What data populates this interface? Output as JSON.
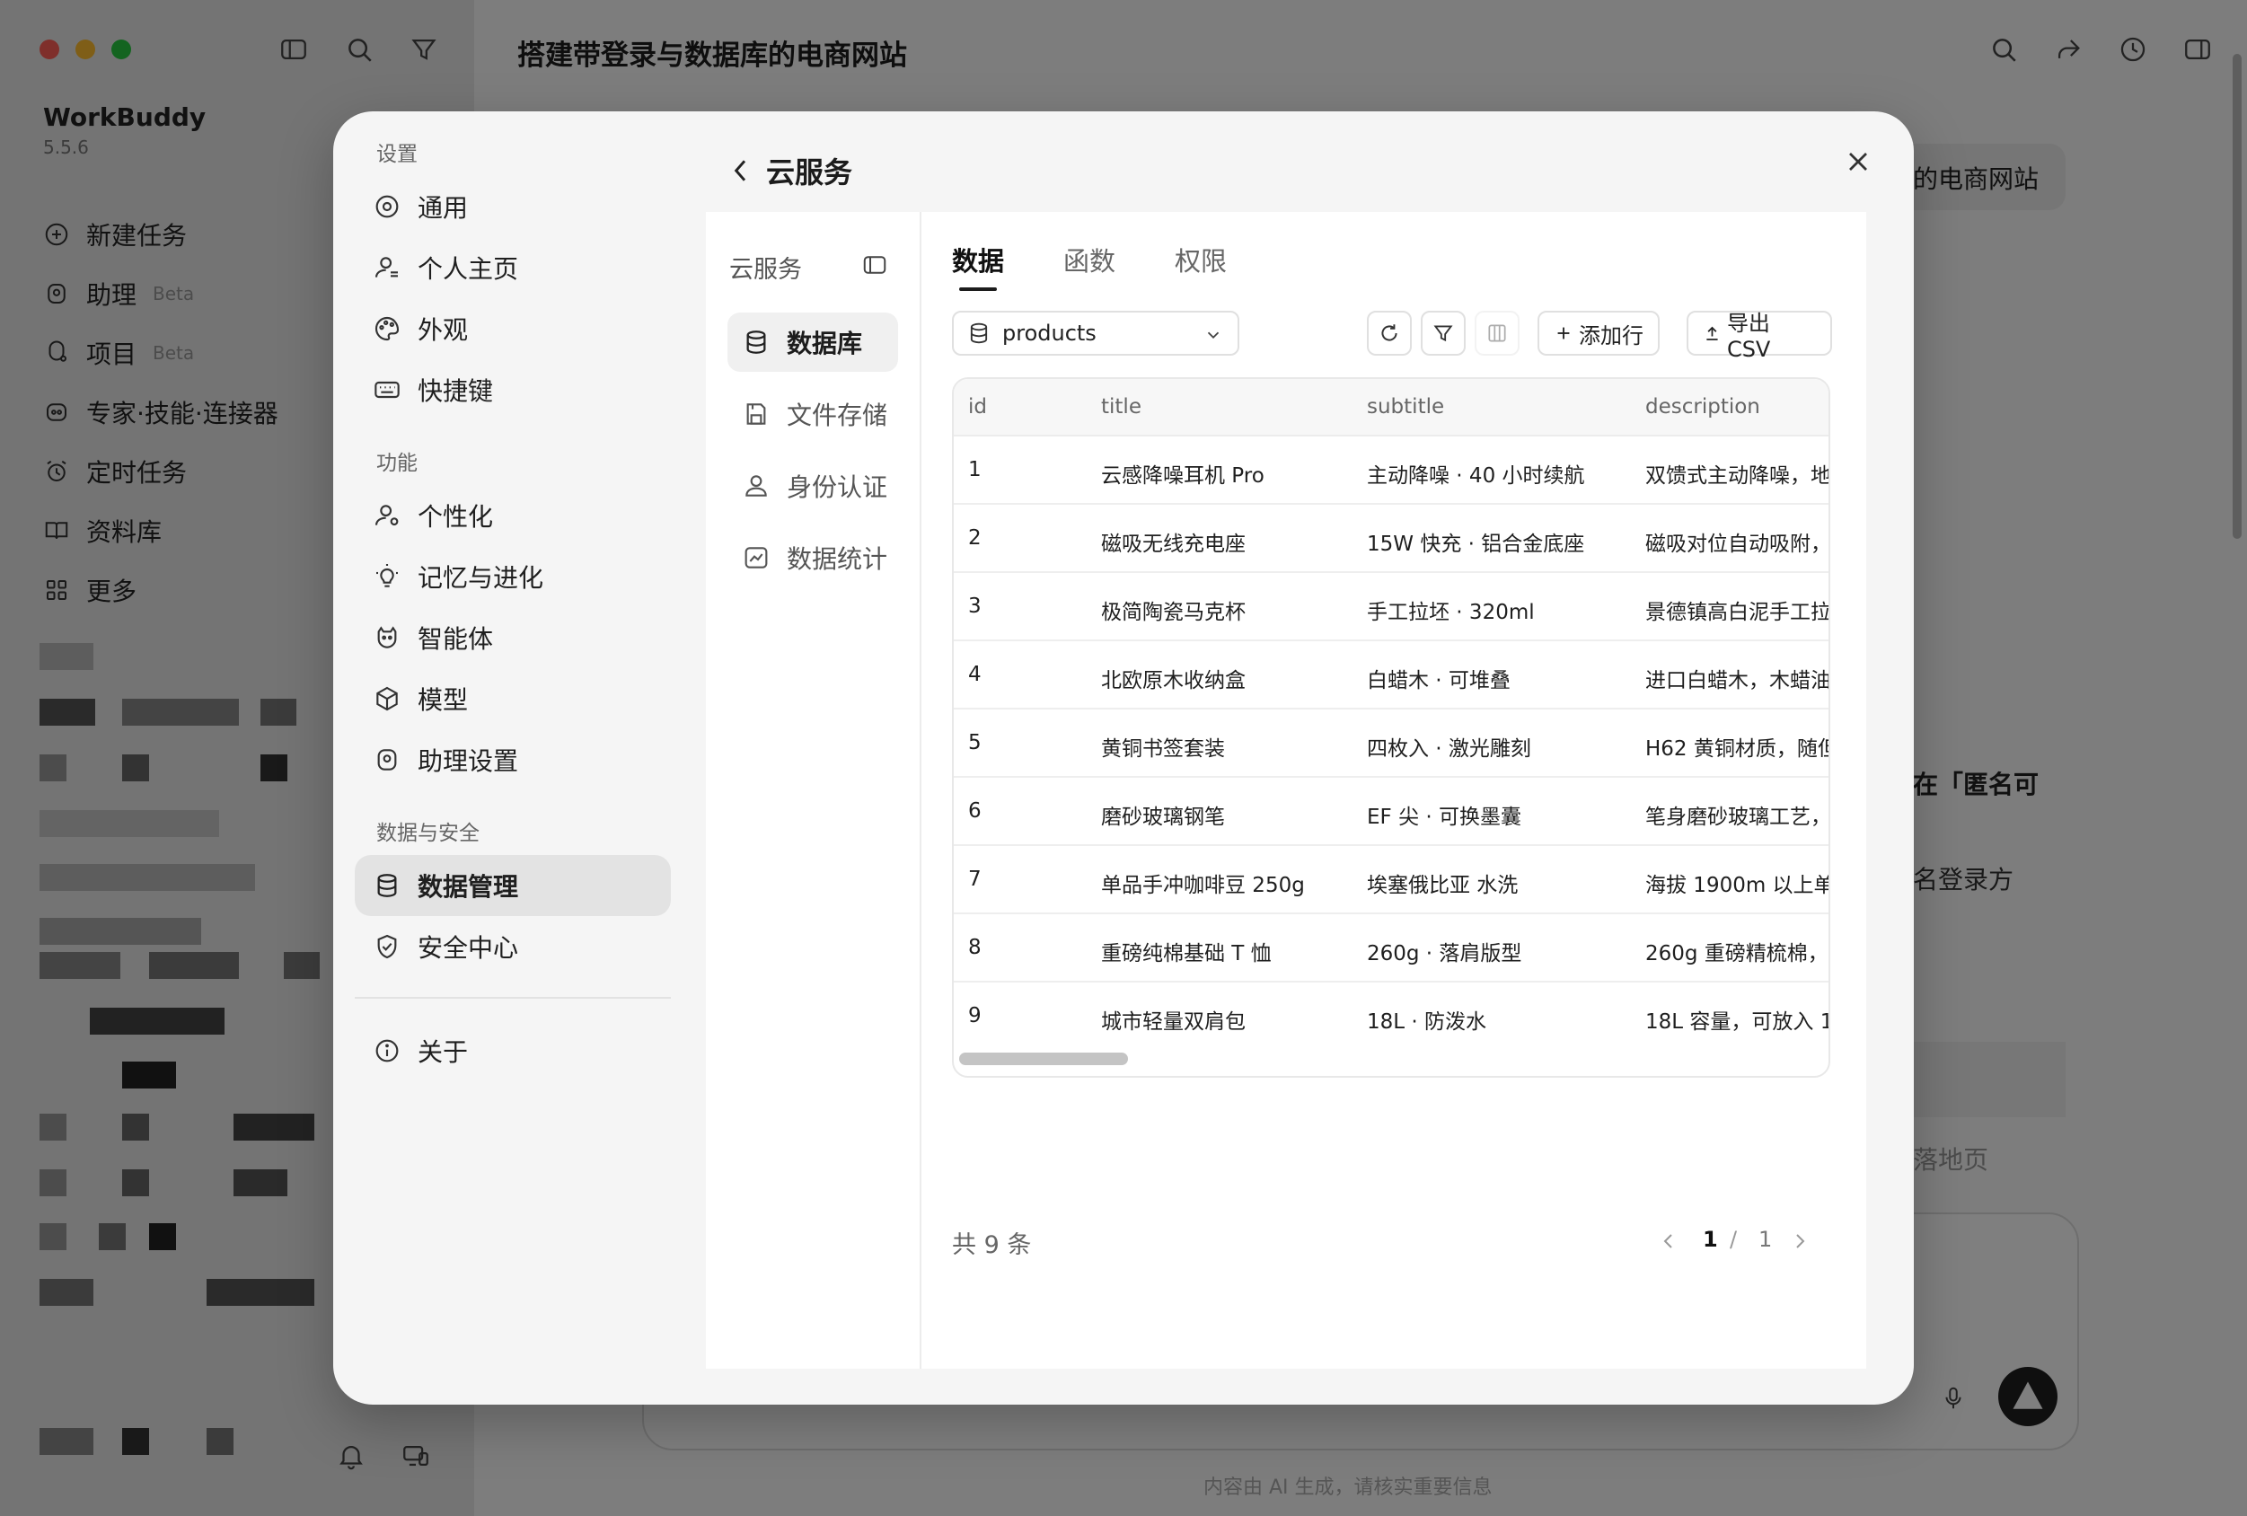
{
  "app": {
    "name": "WorkBuddy",
    "version": "5.5.6",
    "page_title": "搭建带登录与数据库的电商网站",
    "nav": [
      {
        "label": "新建任务",
        "icon": "plus-circle-icon"
      },
      {
        "label": "助理",
        "badge": "Beta",
        "icon": "assistant-icon"
      },
      {
        "label": "项目",
        "badge": "Beta",
        "icon": "project-icon"
      },
      {
        "label": "专家·技能·连接器",
        "icon": "expert-icon"
      },
      {
        "label": "定时任务",
        "icon": "alarm-icon"
      },
      {
        "label": "资料库",
        "icon": "book-icon"
      },
      {
        "label": "更多",
        "icon": "grid-icon"
      }
    ],
    "chat_bubble": "的电商网站",
    "bg_bold": "在「匿名可",
    "bg_text": "名登录方",
    "bg_gray": "落地页",
    "disclaimer": "内容由 AI 生成，请核实重要信息"
  },
  "settings": {
    "header": "设置",
    "sections": [
      {
        "label": "",
        "items": [
          {
            "label": "通用",
            "icon": "general-icon"
          },
          {
            "label": "个人主页",
            "icon": "profile-icon"
          },
          {
            "label": "外观",
            "icon": "palette-icon"
          },
          {
            "label": "快捷键",
            "icon": "keyboard-icon"
          }
        ]
      },
      {
        "label": "功能",
        "items": [
          {
            "label": "个性化",
            "icon": "personalize-icon"
          },
          {
            "label": "记忆与进化",
            "icon": "bulb-icon"
          },
          {
            "label": "智能体",
            "icon": "agent-icon"
          },
          {
            "label": "模型",
            "icon": "cube-icon"
          },
          {
            "label": "助理设置",
            "icon": "assistant-icon"
          }
        ]
      },
      {
        "label": "数据与安全",
        "items": [
          {
            "label": "数据管理",
            "icon": "database-icon",
            "active": true
          },
          {
            "label": "安全中心",
            "icon": "shield-check-icon"
          }
        ]
      }
    ],
    "about": "关于"
  },
  "cloud": {
    "title": "云服务",
    "nav_header": "云服务",
    "nav": [
      {
        "label": "数据库",
        "icon": "database-icon",
        "active": true
      },
      {
        "label": "文件存储",
        "icon": "save-icon"
      },
      {
        "label": "身份认证",
        "icon": "user-icon"
      },
      {
        "label": "数据统计",
        "icon": "chart-icon"
      }
    ],
    "tabs": [
      {
        "label": "数据",
        "active": true
      },
      {
        "label": "函数"
      },
      {
        "label": "权限"
      }
    ],
    "table_select": "products",
    "add_row": "添加行",
    "export": "导出 CSV",
    "columns": [
      "id",
      "title",
      "subtitle",
      "description"
    ],
    "rows": [
      {
        "id": "1",
        "title": "云感降噪耳机 Pro",
        "subtitle": "主动降噪 · 40 小时续航",
        "description": "双馈式主动降噪，地"
      },
      {
        "id": "2",
        "title": "磁吸无线充电座",
        "subtitle": "15W 快充 · 铝合金底座",
        "description": "磁吸对位自动吸附，"
      },
      {
        "id": "3",
        "title": "极简陶瓷马克杯",
        "subtitle": "手工拉坯 · 320ml",
        "description": "景德镇高白泥手工拉"
      },
      {
        "id": "4",
        "title": "北欧原木收纳盒",
        "subtitle": "白蜡木 · 可堆叠",
        "description": "进口白蜡木，木蜡油"
      },
      {
        "id": "5",
        "title": "黄铜书签套装",
        "subtitle": "四枚入 · 激光雕刻",
        "description": "H62 黄铜材质，随但"
      },
      {
        "id": "6",
        "title": "磨砂玻璃钢笔",
        "subtitle": "EF 尖 · 可换墨囊",
        "description": "笔身磨砂玻璃工艺，"
      },
      {
        "id": "7",
        "title": "单品手冲咖啡豆 250g",
        "subtitle": "埃塞俄比亚 水洗",
        "description": "海拔 1900m 以上单"
      },
      {
        "id": "8",
        "title": "重磅纯棉基础 T 恤",
        "subtitle": "260g · 落肩版型",
        "description": "260g 重磅精梳棉，"
      },
      {
        "id": "9",
        "title": "城市轻量双肩包",
        "subtitle": "18L · 防泼水",
        "description": "18L 容量，可放入 1"
      }
    ],
    "total": "共 9 条",
    "page_current": "1",
    "page_sep": "/",
    "page_total": "1"
  },
  "colors": {
    "traffic_red": "#ff5f57",
    "traffic_yellow": "#febc2e",
    "traffic_green": "#28c840",
    "active_item_bg": "#e3e3e3"
  }
}
